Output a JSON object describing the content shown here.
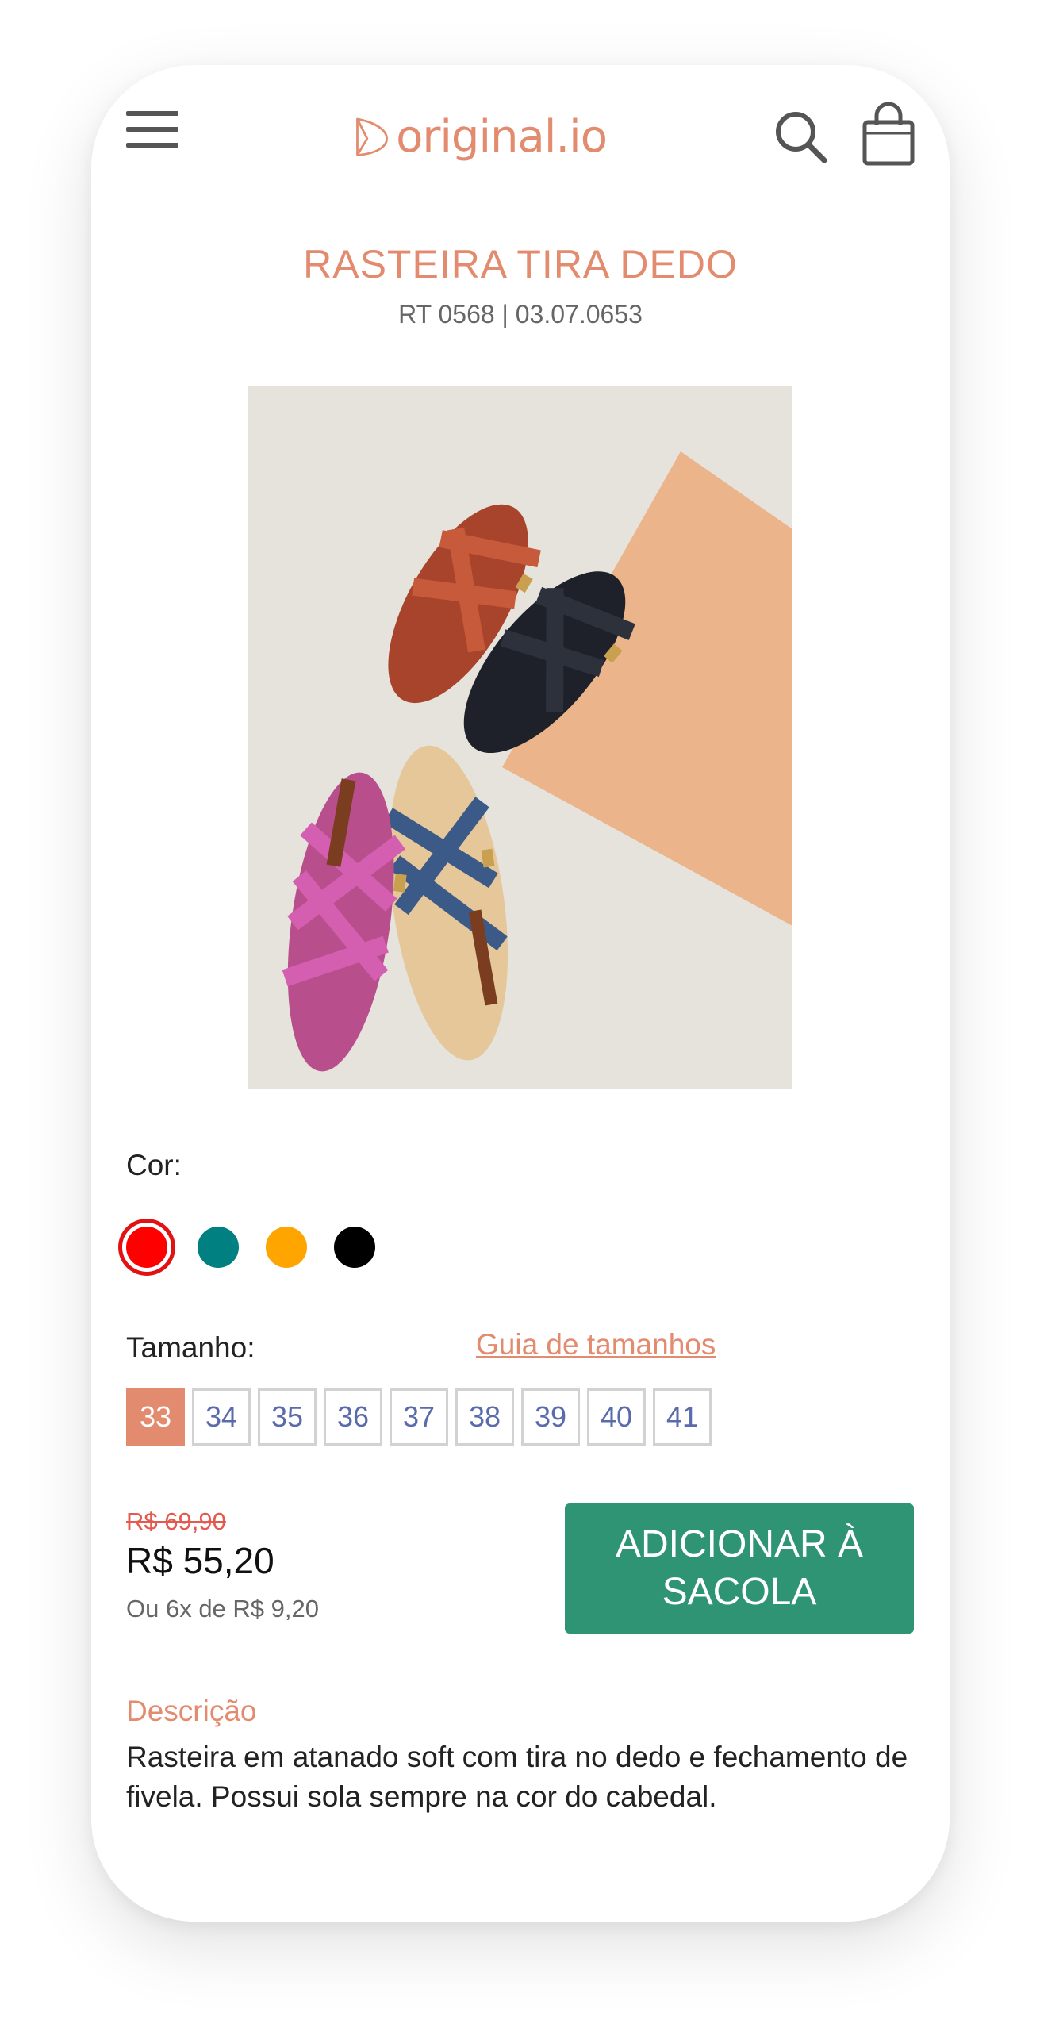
{
  "header": {
    "logo_text": "original.io",
    "menu_icon": "hamburger-menu-icon",
    "search_icon": "search-icon",
    "bag_icon": "shopping-bag-icon"
  },
  "product": {
    "title": "RASTEIRA TIRA DEDO",
    "sku": "RT 0568 | 03.07.0653"
  },
  "color": {
    "label": "Cor:",
    "options": [
      {
        "name": "red",
        "hex": "#ff0000",
        "selected": true
      },
      {
        "name": "teal",
        "hex": "#008080",
        "selected": false
      },
      {
        "name": "orange",
        "hex": "#ffa500",
        "selected": false
      },
      {
        "name": "black",
        "hex": "#000000",
        "selected": false
      }
    ]
  },
  "size": {
    "label": "Tamanho:",
    "guide_link": "Guia de tamanhos",
    "options": [
      "33",
      "34",
      "35",
      "36",
      "37",
      "38",
      "39",
      "40",
      "41"
    ],
    "selected": "33"
  },
  "price": {
    "old": "R$ 69,90",
    "current": "R$ 55,20",
    "installments": "Ou 6x de R$ 9,20"
  },
  "cta": {
    "label_line1": "ADICIONAR À",
    "label_line2": "SACOLA"
  },
  "description": {
    "title": "Descrição",
    "text": "Rasteira em atanado soft com tira no dedo e fechamento de fivela. Possui sola sempre na cor do cabedal."
  },
  "colors": {
    "accent": "#e38b6e",
    "cta": "#2f9474",
    "size_text": "#5a6bab"
  }
}
